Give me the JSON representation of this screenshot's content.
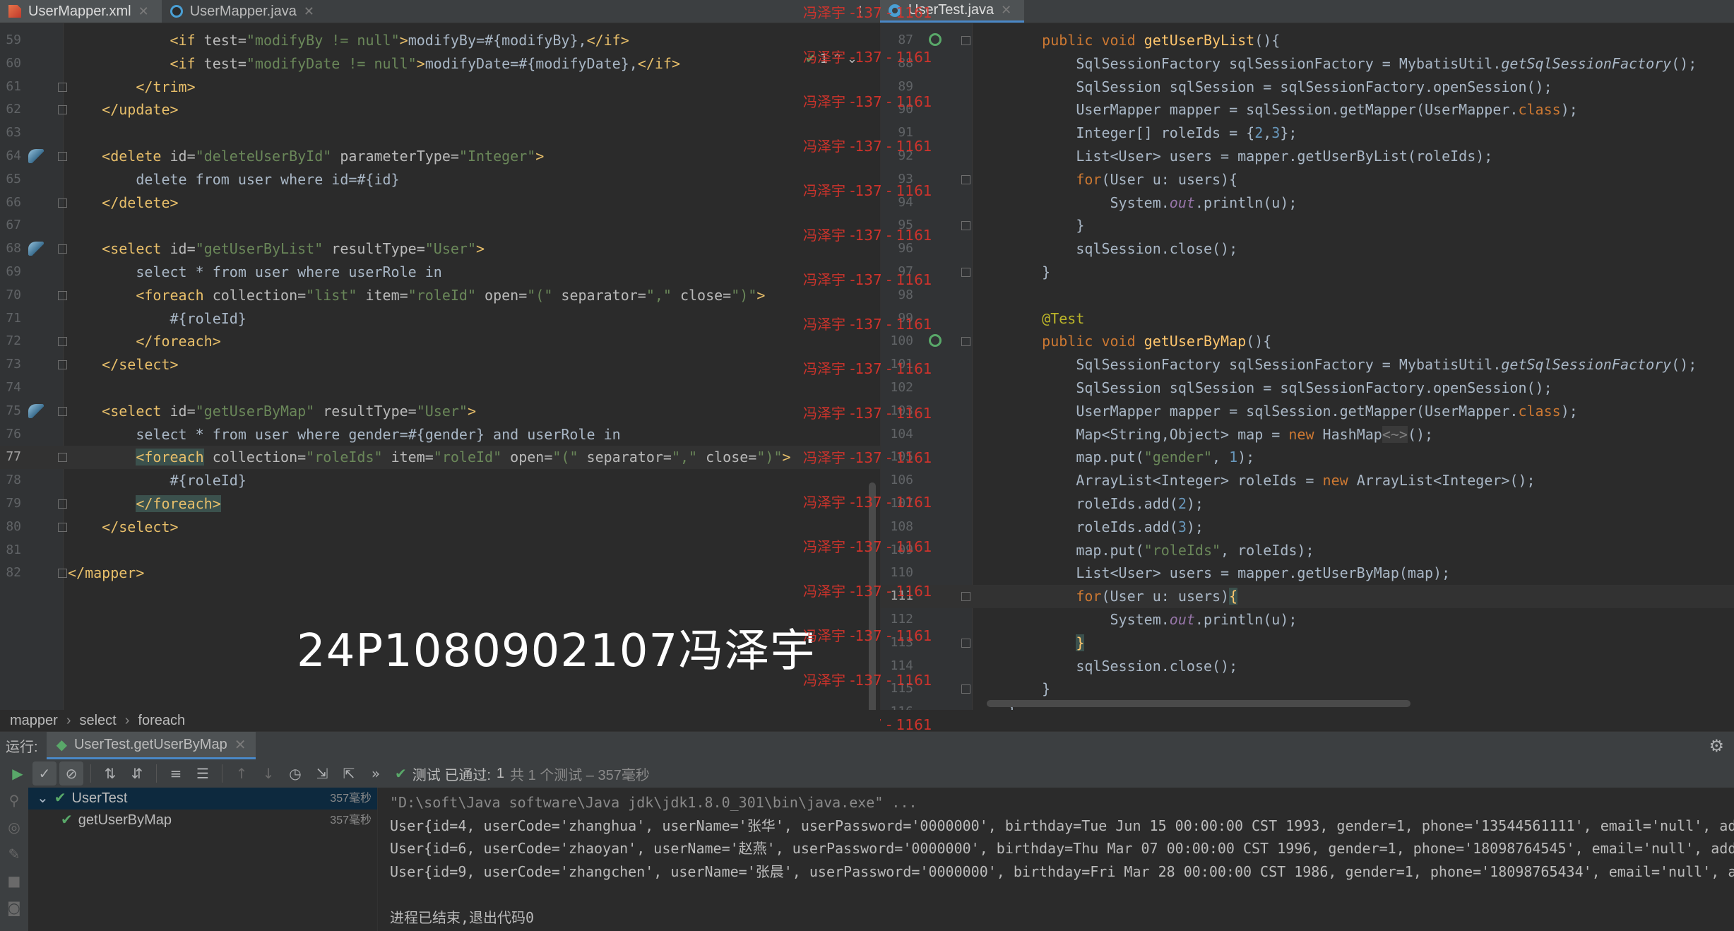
{
  "left_tabs": [
    {
      "label": "UserMapper.xml",
      "icon": "xml-file-icon",
      "active": true
    },
    {
      "label": "UserMapper.java",
      "icon": "java-interface-icon",
      "active": false
    }
  ],
  "right_tabs": [
    {
      "label": "UserTest.java",
      "icon": "java-class-icon",
      "active": true
    }
  ],
  "inspection": {
    "count": "1"
  },
  "left_editor": {
    "current_line": "77",
    "lines": [
      {
        "n": "59",
        "parts": [
          [
            "txt",
            "            "
          ],
          [
            "tag",
            "<if "
          ],
          [
            "attr",
            "test="
          ],
          [
            "str",
            "\"modifyBy != null\""
          ],
          [
            "tag",
            ">"
          ],
          [
            "txt",
            "modifyBy=#{modifyBy},"
          ],
          [
            "tag",
            "</if>"
          ]
        ]
      },
      {
        "n": "60",
        "parts": [
          [
            "txt",
            "            "
          ],
          [
            "tag",
            "<if "
          ],
          [
            "attr",
            "test="
          ],
          [
            "str",
            "\"modifyDate != null\""
          ],
          [
            "tag",
            ">"
          ],
          [
            "txt",
            "modifyDate=#{modifyDate},"
          ],
          [
            "tag",
            "</if>"
          ]
        ]
      },
      {
        "n": "61",
        "fold": true,
        "parts": [
          [
            "txt",
            "        "
          ],
          [
            "tag",
            "</trim>"
          ]
        ]
      },
      {
        "n": "62",
        "fold": true,
        "parts": [
          [
            "txt",
            "    "
          ],
          [
            "tag",
            "</update>"
          ]
        ]
      },
      {
        "n": "63",
        "parts": []
      },
      {
        "n": "64",
        "fold": true,
        "mark": "bird",
        "parts": [
          [
            "txt",
            "    "
          ],
          [
            "tag",
            "<delete "
          ],
          [
            "attr",
            "id="
          ],
          [
            "str",
            "\"deleteUserById\""
          ],
          [
            "attr",
            " parameterType="
          ],
          [
            "str",
            "\"Integer\""
          ],
          [
            "tag",
            ">"
          ]
        ]
      },
      {
        "n": "65",
        "parts": [
          [
            "txt",
            "        delete from user where id=#{id}"
          ]
        ]
      },
      {
        "n": "66",
        "fold": true,
        "parts": [
          [
            "txt",
            "    "
          ],
          [
            "tag",
            "</delete>"
          ]
        ]
      },
      {
        "n": "67",
        "parts": []
      },
      {
        "n": "68",
        "fold": true,
        "mark": "bird",
        "parts": [
          [
            "txt",
            "    "
          ],
          [
            "tag",
            "<select "
          ],
          [
            "attr",
            "id="
          ],
          [
            "str",
            "\"getUserByList\""
          ],
          [
            "attr",
            " resultType="
          ],
          [
            "str",
            "\"User\""
          ],
          [
            "tag",
            ">"
          ]
        ]
      },
      {
        "n": "69",
        "parts": [
          [
            "txt",
            "        select * from user where userRole in"
          ]
        ]
      },
      {
        "n": "70",
        "fold": true,
        "parts": [
          [
            "txt",
            "        "
          ],
          [
            "tag",
            "<foreach "
          ],
          [
            "attr",
            "collection="
          ],
          [
            "str",
            "\"list\""
          ],
          [
            "attr",
            " item="
          ],
          [
            "str",
            "\"roleId\""
          ],
          [
            "attr",
            " open="
          ],
          [
            "str",
            "\"(\""
          ],
          [
            "attr",
            " separator="
          ],
          [
            "str",
            "\",\""
          ],
          [
            "attr",
            " close="
          ],
          [
            "str",
            "\")\""
          ],
          [
            "tag",
            ">"
          ]
        ]
      },
      {
        "n": "71",
        "parts": [
          [
            "txt",
            "            #{roleId}"
          ]
        ]
      },
      {
        "n": "72",
        "fold": true,
        "parts": [
          [
            "txt",
            "        "
          ],
          [
            "tag",
            "</foreach>"
          ]
        ]
      },
      {
        "n": "73",
        "fold": true,
        "parts": [
          [
            "txt",
            "    "
          ],
          [
            "tag",
            "</select>"
          ]
        ]
      },
      {
        "n": "74",
        "parts": []
      },
      {
        "n": "75",
        "fold": true,
        "mark": "bird",
        "parts": [
          [
            "txt",
            "    "
          ],
          [
            "tag",
            "<select "
          ],
          [
            "attr",
            "id="
          ],
          [
            "str",
            "\"getUserByMap\""
          ],
          [
            "attr",
            " resultType="
          ],
          [
            "str",
            "\"User\""
          ],
          [
            "tag",
            ">"
          ]
        ]
      },
      {
        "n": "76",
        "parts": [
          [
            "txt",
            "        select * from user where gender=#{gender} and userRole in"
          ]
        ]
      },
      {
        "n": "77",
        "fold": true,
        "parts": [
          [
            "txt",
            "        "
          ],
          [
            "tag hl",
            "<foreach"
          ],
          [
            "tag",
            " "
          ],
          [
            "attr",
            "collection="
          ],
          [
            "str",
            "\"roleIds\""
          ],
          [
            "attr",
            " item="
          ],
          [
            "str",
            "\"roleId\""
          ],
          [
            "attr",
            " open="
          ],
          [
            "str",
            "\"(\""
          ],
          [
            "attr",
            " separator="
          ],
          [
            "str",
            "\",\""
          ],
          [
            "attr",
            " close="
          ],
          [
            "str",
            "\")\""
          ],
          [
            "tag",
            ">"
          ]
        ]
      },
      {
        "n": "78",
        "parts": [
          [
            "txt",
            "            #{roleId}"
          ]
        ]
      },
      {
        "n": "79",
        "fold": true,
        "parts": [
          [
            "txt",
            "        "
          ],
          [
            "tag hl",
            "</foreach>"
          ]
        ]
      },
      {
        "n": "80",
        "fold": true,
        "parts": [
          [
            "txt",
            "    "
          ],
          [
            "tag",
            "</select>"
          ]
        ]
      },
      {
        "n": "81",
        "parts": []
      },
      {
        "n": "82",
        "fold": true,
        "parts": [
          [
            "tag",
            "</mapper>"
          ]
        ]
      }
    ]
  },
  "right_editor": {
    "current_line": "111",
    "lines": [
      {
        "n": "87",
        "fold": true,
        "mark": "run",
        "parts": [
          [
            "txt",
            "    "
          ],
          [
            "kw",
            "public void "
          ],
          [
            "fn",
            "getUserByList"
          ],
          [
            "txt",
            "(){"
          ]
        ]
      },
      {
        "n": "88",
        "parts": [
          [
            "txt",
            "        SqlSessionFactory sqlSessionFactory = MybatisUtil."
          ],
          [
            "sit",
            "getSqlSessionFactory"
          ],
          [
            "txt",
            "();"
          ]
        ]
      },
      {
        "n": "89",
        "parts": [
          [
            "txt",
            "        SqlSession sqlSession = sqlSessionFactory.openSession();"
          ]
        ]
      },
      {
        "n": "90",
        "parts": [
          [
            "txt",
            "        UserMapper mapper = sqlSession.getMapper(UserMapper."
          ],
          [
            "kw",
            "class"
          ],
          [
            "txt",
            ");"
          ]
        ]
      },
      {
        "n": "91",
        "parts": [
          [
            "txt",
            "        Integer[] roleIds = {"
          ],
          [
            "num",
            "2"
          ],
          [
            "txt",
            ","
          ],
          [
            "num",
            "3"
          ],
          [
            "txt",
            "};"
          ]
        ]
      },
      {
        "n": "92",
        "parts": [
          [
            "txt",
            "        List<User> users = mapper.getUserByList(roleIds);"
          ]
        ]
      },
      {
        "n": "93",
        "fold": true,
        "parts": [
          [
            "txt",
            "        "
          ],
          [
            "kw",
            "for"
          ],
          [
            "txt",
            "(User u: users){"
          ]
        ]
      },
      {
        "n": "94",
        "parts": [
          [
            "txt",
            "            System."
          ],
          [
            "it",
            "out"
          ],
          [
            "txt",
            ".println(u);"
          ]
        ]
      },
      {
        "n": "95",
        "fold": true,
        "parts": [
          [
            "txt",
            "        }"
          ]
        ]
      },
      {
        "n": "96",
        "parts": [
          [
            "txt",
            "        sqlSession.close();"
          ]
        ]
      },
      {
        "n": "97",
        "fold": true,
        "parts": [
          [
            "txt",
            "    }"
          ]
        ]
      },
      {
        "n": "98",
        "parts": []
      },
      {
        "n": "99",
        "parts": [
          [
            "ann",
            "    @Test"
          ]
        ]
      },
      {
        "n": "100",
        "fold": true,
        "mark": "run",
        "parts": [
          [
            "txt",
            "    "
          ],
          [
            "kw",
            "public void "
          ],
          [
            "fn",
            "getUserByMap"
          ],
          [
            "txt",
            "(){"
          ]
        ]
      },
      {
        "n": "101",
        "parts": [
          [
            "txt",
            "        SqlSessionFactory sqlSessionFactory = MybatisUtil."
          ],
          [
            "sit",
            "getSqlSessionFactory"
          ],
          [
            "txt",
            "();"
          ]
        ]
      },
      {
        "n": "102",
        "parts": [
          [
            "txt",
            "        SqlSession sqlSession = sqlSessionFactory.openSession();"
          ]
        ]
      },
      {
        "n": "103",
        "parts": [
          [
            "txt",
            "        UserMapper mapper = sqlSession.getMapper(UserMapper."
          ],
          [
            "kw",
            "class"
          ],
          [
            "txt",
            ");"
          ]
        ]
      },
      {
        "n": "104",
        "parts": [
          [
            "txt",
            "        Map<String,Object> map = "
          ],
          [
            "kw",
            "new "
          ],
          [
            "txt",
            "HashMap"
          ],
          [
            "fbox",
            "<~>"
          ],
          [
            "txt",
            "();"
          ]
        ]
      },
      {
        "n": "105",
        "parts": [
          [
            "txt",
            "        map.put("
          ],
          [
            "str",
            "\"gender\""
          ],
          [
            "txt",
            ", "
          ],
          [
            "num",
            "1"
          ],
          [
            "txt",
            ");"
          ]
        ]
      },
      {
        "n": "106",
        "parts": [
          [
            "txt",
            "        ArrayList<Integer> roleIds = "
          ],
          [
            "kw",
            "new "
          ],
          [
            "txt",
            "ArrayList<Integer>();"
          ]
        ]
      },
      {
        "n": "107",
        "parts": [
          [
            "txt",
            "        roleIds.add("
          ],
          [
            "num",
            "2"
          ],
          [
            "txt",
            ");"
          ]
        ]
      },
      {
        "n": "108",
        "parts": [
          [
            "txt",
            "        roleIds.add("
          ],
          [
            "num",
            "3"
          ],
          [
            "txt",
            ");"
          ]
        ]
      },
      {
        "n": "109",
        "parts": [
          [
            "txt",
            "        map.put("
          ],
          [
            "str",
            "\"roleIds\""
          ],
          [
            "txt",
            ", roleIds);"
          ]
        ]
      },
      {
        "n": "110",
        "parts": [
          [
            "txt",
            "        List<User> users = mapper.getUserByMap(map);"
          ]
        ]
      },
      {
        "n": "111",
        "fold": true,
        "parts": [
          [
            "txt",
            "        "
          ],
          [
            "kw",
            "for"
          ],
          [
            "txt",
            "(User u: users)"
          ],
          [
            "fn hl",
            "{"
          ]
        ]
      },
      {
        "n": "112",
        "parts": [
          [
            "txt",
            "            System."
          ],
          [
            "it",
            "out"
          ],
          [
            "txt",
            ".println(u);"
          ]
        ]
      },
      {
        "n": "113",
        "fold": true,
        "parts": [
          [
            "txt",
            "        "
          ],
          [
            "fn hl",
            "}"
          ]
        ]
      },
      {
        "n": "114",
        "parts": [
          [
            "txt",
            "        sqlSession.close();"
          ]
        ]
      },
      {
        "n": "115",
        "fold": true,
        "parts": [
          [
            "txt",
            "    }"
          ]
        ]
      },
      {
        "n": "116",
        "parts": [
          [
            "txt",
            "}"
          ]
        ]
      }
    ]
  },
  "watermark": "24P1080902107冯泽宇",
  "stamp_text": "冯泽宇 -137 - 1161",
  "stamp_count": 21,
  "breadcrumb": [
    "mapper",
    "select",
    "foreach"
  ],
  "run_panel": {
    "label": "运行:",
    "tab": "UserTest.getUserByMap",
    "status_text": "测试 已通过:",
    "status_count": "1",
    "status_detail": "共 1 个测试 – 357毫秒"
  },
  "test_tree": [
    {
      "label": "UserTest",
      "time": "357毫秒",
      "selected": true,
      "indent": 0
    },
    {
      "label": "getUserByMap",
      "time": "357毫秒",
      "selected": false,
      "indent": 1
    }
  ],
  "console": [
    {
      "cls": "cmd",
      "text": "\"D:\\soft\\Java software\\Java jdk\\jdk1.8.0_301\\bin\\java.exe\" ..."
    },
    {
      "cls": "",
      "text": "User{id=4, userCode='zhanghua', userName='张华', userPassword='0000000', birthday=Tue Jun 15 00:00:00 CST 1993, gender=1, phone='13544561111', email='null', ad"
    },
    {
      "cls": "",
      "text": "User{id=6, userCode='zhaoyan', userName='赵燕', userPassword='0000000', birthday=Thu Mar 07 00:00:00 CST 1996, gender=1, phone='18098764545', email='null', add"
    },
    {
      "cls": "",
      "text": "User{id=9, userCode='zhangchen', userName='张晨', userPassword='0000000', birthday=Fri Mar 28 00:00:00 CST 1986, gender=1, phone='18098765434', email='null', a"
    },
    {
      "cls": "",
      "text": ""
    },
    {
      "cls": "exit",
      "text": "进程已结束,退出代码0"
    }
  ],
  "colors": {
    "accent": "#4a88c7",
    "pass_green": "#59a869",
    "stamp_red": "#d8342c"
  }
}
